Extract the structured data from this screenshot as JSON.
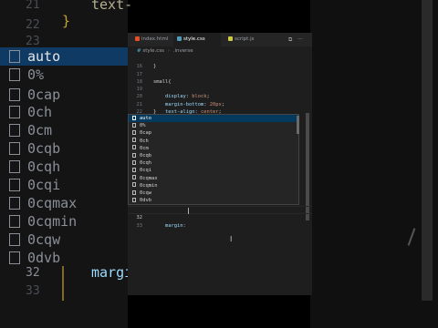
{
  "background": {
    "suggestions": [
      "auto",
      "0%",
      "0cap",
      "0ch",
      "0cm",
      "0cqb",
      "0cqh",
      "0cqi",
      "0cqmax",
      "0cqmin",
      "0cqw",
      "0dvb"
    ],
    "line_numbers": {
      "top": [
        "21",
        "22",
        "23"
      ],
      "bottom": [
        "32",
        "33"
      ]
    },
    "code_text_top": "text-",
    "code_brace": "}",
    "code_text_bottom": "margi"
  },
  "editor": {
    "tabs": [
      {
        "label": "index.html",
        "icon_color": "#e44d26",
        "active": false
      },
      {
        "label": "style.css",
        "icon_color": "#519aba",
        "active": true
      },
      {
        "label": "script.js",
        "icon_color": "#cbcb41",
        "active": false
      }
    ],
    "tab_actions": {
      "split": "⧉",
      "more": "···"
    },
    "breadcrumb": {
      "file_icon": "#",
      "file": "style.css",
      "symbol": ".inverse"
    },
    "code_lines": [
      {
        "num": "16",
        "text": "}"
      },
      {
        "num": "17",
        "text": ""
      },
      {
        "num": "18",
        "text": "small{"
      },
      {
        "num": "19",
        "prop": "display",
        "value": "block"
      },
      {
        "num": "20",
        "prop": "margin-bottom",
        "value": "20px"
      },
      {
        "num": "21",
        "prop": "text-align",
        "value": "center"
      },
      {
        "num": "22",
        "text": "}"
      },
      {
        "num": "23",
        "text": ""
      }
    ],
    "current_line": {
      "num": "32",
      "prop": "margin"
    },
    "next_line_num": "33",
    "suggestions": [
      "auto",
      "0%",
      "0cap",
      "0ch",
      "0cm",
      "0cqb",
      "0cqh",
      "0cqi",
      "0cqmax",
      "0cqmin",
      "0cqw",
      "0dvb"
    ],
    "selected_suggestion_index": 0,
    "colors": {
      "editor_bg": "#1e1e1e",
      "selection": "#04395e",
      "property": "#9cdcfe",
      "value": "#ce9178",
      "selector": "#d7ba7d",
      "brace": "#ffd700"
    }
  }
}
